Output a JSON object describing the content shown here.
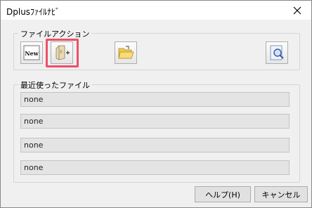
{
  "window": {
    "title": "Dplusﾌｧｲﾙﾅﾋﾞ",
    "close_icon": "close-icon"
  },
  "actions_group": {
    "label": "ファイルアクション",
    "buttons": [
      {
        "name": "new-file-button",
        "icon": "new-document-icon",
        "text": "New"
      },
      {
        "name": "add-to-cabinet-button",
        "icon": "cabinet-add-icon"
      },
      {
        "name": "open-folder-button",
        "icon": "open-folder-icon"
      },
      {
        "name": "search-file-button",
        "icon": "search-document-icon"
      }
    ],
    "highlight_color": "#ef4f68"
  },
  "recent_group": {
    "label": "最近使ったファイル",
    "files": [
      "none",
      "none",
      "none",
      "none"
    ]
  },
  "footer": {
    "help_label": "ヘルプ(H)",
    "cancel_label": "キャンセル"
  }
}
